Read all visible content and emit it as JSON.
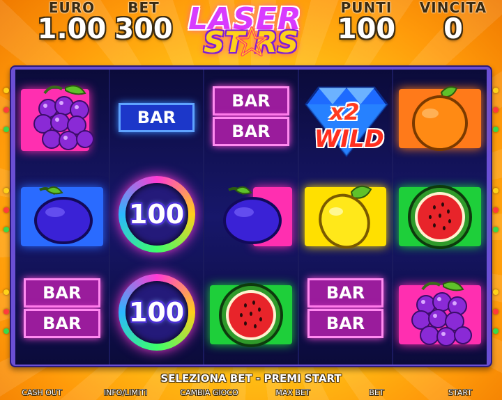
{
  "header": {
    "euro": {
      "label": "EURO",
      "value": "1.00"
    },
    "bet": {
      "label": "BET",
      "value": "300"
    },
    "punti": {
      "label": "PUNTI",
      "value": "100"
    },
    "vincita": {
      "label": "VINCITA",
      "value": "0"
    }
  },
  "logo": {
    "line1": "LASER",
    "line2": "ST RS"
  },
  "reels": {
    "bar_label": "BAR",
    "hundred_label": "100",
    "wild_multiplier": "x2",
    "wild_label": "WILD",
    "grid": [
      [
        "grapes",
        "plum",
        "bar-double"
      ],
      [
        "bar-single",
        "hundred",
        "hundred"
      ],
      [
        "bar-double",
        "plum",
        "watermelon"
      ],
      [
        "diamond-wild-x2",
        "lemon",
        "bar-double"
      ],
      [
        "orange",
        "watermelon",
        "grapes"
      ]
    ]
  },
  "status_text": "SELEZIONA BET - PREMI START",
  "buttons": {
    "cash_out": "CASH OUT",
    "info": "INFO/LIMITI",
    "change_game": "CAMBIA GIOCO",
    "max_bet": "MAX BET",
    "bet": "BET",
    "start": "START"
  },
  "colors": {
    "bar_pink": "#ff2fb0",
    "bar_blue": "#2a6bff",
    "accent_yellow": "#ffd21a"
  }
}
